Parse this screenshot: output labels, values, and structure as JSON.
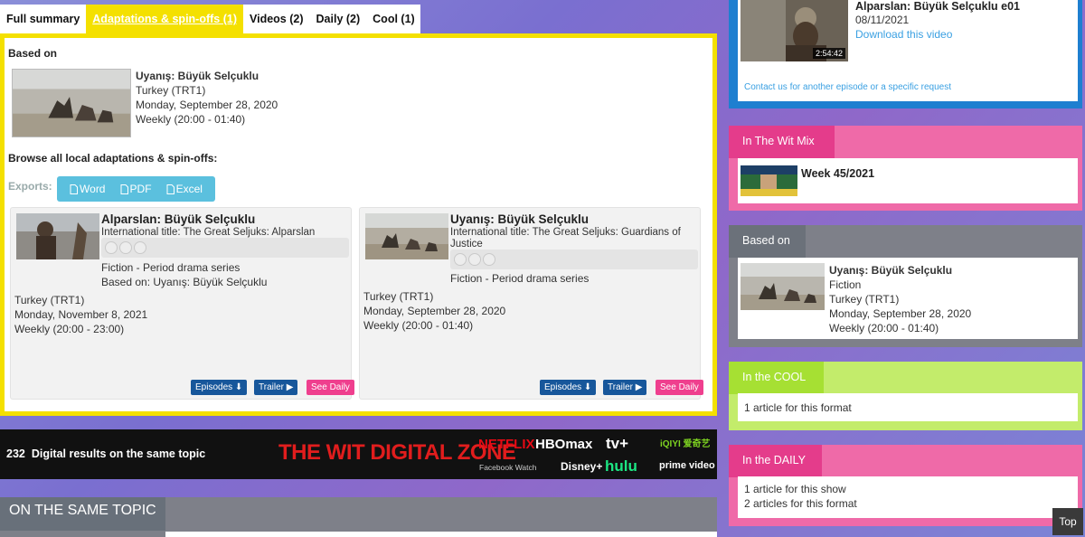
{
  "tabs": [
    {
      "label": "Full summary"
    },
    {
      "label": "Adaptations & spin-offs (1)"
    },
    {
      "label": "Videos (2)"
    },
    {
      "label": "Daily (2)"
    },
    {
      "label": "Cool (1)"
    }
  ],
  "main": {
    "based_on_heading": "Based on",
    "based_on": {
      "title": "Uyanış: Büyük Selçuklu",
      "country": "Turkey (TRT1)",
      "date": "Monday, September 28, 2020",
      "schedule": "Weekly (20:00 - 01:40)"
    },
    "browse_heading": "Browse all local adaptations & spin-offs:",
    "exports_label": "Exports:",
    "exports": [
      "Word",
      "PDF",
      "Excel"
    ],
    "cards": [
      {
        "title": "Alparslan: Büyük Selçuklu",
        "intl_title": "International title: The Great Seljuks: Alparslan",
        "genre": "Fiction - Period drama series",
        "based_on": "Based on: Uyanış: Büyük Selçuklu",
        "country": "Turkey (TRT1)",
        "date": "Monday, November 8, 2021",
        "schedule": "Weekly (20:00 - 23:00)"
      },
      {
        "title": "Uyanış: Büyük Selçuklu",
        "intl_title": "International title: The Great Seljuks: Guardians of Justice",
        "genre": "Fiction - Period drama series",
        "country": "Turkey (TRT1)",
        "date": "Monday, September 28, 2020",
        "schedule": "Weekly (20:00 - 01:40)"
      }
    ],
    "card_buttons": {
      "episodes": "Episodes",
      "trailer": "Trailer",
      "see_daily": "See Daily"
    }
  },
  "digital_bar": {
    "count": "232",
    "text": "Digital results on the same topic",
    "zone": "THE WIT DIGITAL ZONE",
    "logos": [
      "NETFLIX",
      "HBOmax",
      "tv+",
      "iQIYI 爱奇艺",
      "Facebook Watch",
      "Disney+",
      "hulu",
      "prime video"
    ]
  },
  "same_topic": {
    "heading": "ON THE SAME TOPIC"
  },
  "sidebar": {
    "video": {
      "title": "Alparslan: Büyük Selçuklu e01",
      "date": "08/11/2021",
      "download": "Download this video",
      "duration": "2:54:42",
      "contact": "Contact us for another episode or a specific request"
    },
    "wit_mix": {
      "header": "In The Wit Mix",
      "week": "Week 45/2021"
    },
    "based_on": {
      "header": "Based on",
      "title": "Uyanış: Büyük Selçuklu",
      "genre": "Fiction",
      "country": "Turkey (TRT1)",
      "date": "Monday, September 28, 2020",
      "schedule": "Weekly (20:00 - 01:40)"
    },
    "cool": {
      "header": "In the COOL",
      "text": "1 article for this format"
    },
    "daily": {
      "header": "In the DAILY",
      "line1": "1 article for this show",
      "line2": "2 articles for this format"
    }
  },
  "top_button": "Top",
  "colors": {
    "yellow": "#f4e000",
    "blue": "#1e7fd0",
    "pink": "#e43c8b",
    "grey": "#7e8089",
    "green": "#a6e033",
    "dark_button": "#17579b",
    "link": "#3aa0e2"
  }
}
